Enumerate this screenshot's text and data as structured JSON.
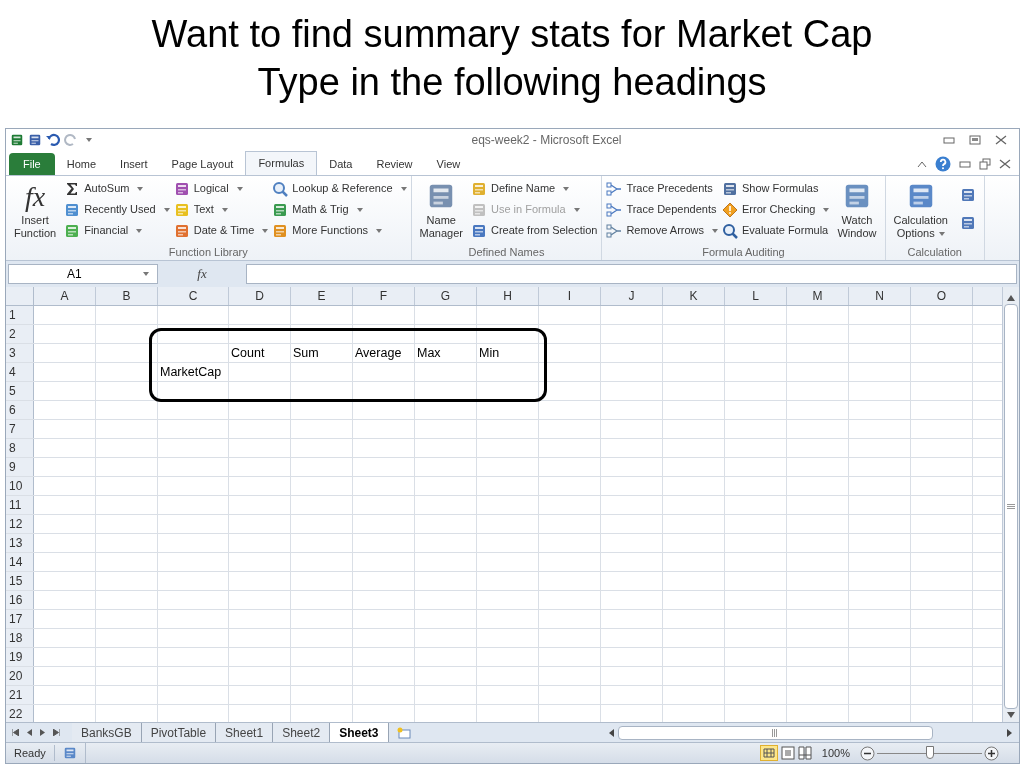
{
  "slide_title": [
    "Want to find summary stats for Market Cap",
    "Type in the following headings"
  ],
  "window": {
    "title": "eqs-week2 - Microsoft Excel"
  },
  "ribbon_tabs": [
    {
      "label": "File",
      "kind": "file",
      "selected": false
    },
    {
      "label": "Home",
      "kind": "tab",
      "selected": false
    },
    {
      "label": "Insert",
      "kind": "tab",
      "selected": false
    },
    {
      "label": "Page Layout",
      "kind": "tab",
      "selected": false
    },
    {
      "label": "Formulas",
      "kind": "tab",
      "selected": true
    },
    {
      "label": "Data",
      "kind": "tab",
      "selected": false
    },
    {
      "label": "Review",
      "kind": "tab",
      "selected": false
    },
    {
      "label": "View",
      "kind": "tab",
      "selected": false
    }
  ],
  "ribbon_groups": [
    {
      "label": "Function Library",
      "controls": [
        {
          "kind": "big",
          "glyph": "fx",
          "lines": [
            "Insert",
            "Function"
          ],
          "dropdown": false
        },
        {
          "kind": "stack",
          "items": [
            {
              "kind": "text",
              "label": "AutoSum",
              "dropdown": true,
              "disabled": false
            },
            {
              "kind": "text",
              "label": "Recently Used",
              "dropdown": true,
              "disabled": false
            },
            {
              "kind": "text",
              "label": "Financial",
              "dropdown": true,
              "disabled": false
            }
          ]
        },
        {
          "kind": "stack",
          "items": [
            {
              "kind": "text",
              "label": "Logical",
              "dropdown": true,
              "disabled": false
            },
            {
              "kind": "text",
              "label": "Text",
              "dropdown": true,
              "disabled": false
            },
            {
              "kind": "text",
              "label": "Date & Time",
              "dropdown": true,
              "disabled": false
            }
          ]
        },
        {
          "kind": "stack",
          "items": [
            {
              "kind": "text",
              "label": "Lookup & Reference",
              "dropdown": true,
              "disabled": false
            },
            {
              "kind": "text",
              "label": "Math & Trig",
              "dropdown": true,
              "disabled": false
            },
            {
              "kind": "text",
              "label": "More Functions",
              "dropdown": true,
              "disabled": false
            }
          ]
        }
      ]
    },
    {
      "label": "Defined Names",
      "controls": [
        {
          "kind": "big",
          "lines": [
            "Name",
            "Manager"
          ],
          "dropdown": false
        },
        {
          "kind": "stack",
          "items": [
            {
              "kind": "text",
              "label": "Define Name",
              "dropdown": true,
              "disabled": false
            },
            {
              "kind": "text",
              "label": "Use in Formula",
              "dropdown": true,
              "disabled": true
            },
            {
              "kind": "text",
              "label": "Create from Selection",
              "dropdown": false,
              "disabled": false
            }
          ]
        }
      ]
    },
    {
      "label": "Formula Auditing",
      "controls": [
        {
          "kind": "stack",
          "items": [
            {
              "kind": "text",
              "label": "Trace Precedents",
              "dropdown": false,
              "disabled": false
            },
            {
              "kind": "text",
              "label": "Trace Dependents",
              "dropdown": false,
              "disabled": false
            },
            {
              "kind": "text",
              "label": "Remove Arrows",
              "dropdown": true,
              "disabled": false
            }
          ]
        },
        {
          "kind": "stack",
          "items": [
            {
              "kind": "text",
              "label": "Show Formulas",
              "dropdown": false,
              "disabled": false
            },
            {
              "kind": "text",
              "label": "Error Checking",
              "dropdown": true,
              "disabled": false
            },
            {
              "kind": "text",
              "label": "Evaluate Formula",
              "dropdown": false,
              "disabled": false
            }
          ]
        },
        {
          "kind": "big",
          "lines": [
            "Watch",
            "Window"
          ],
          "dropdown": false
        }
      ]
    },
    {
      "label": "Calculation",
      "controls": [
        {
          "kind": "big",
          "lines": [
            "Calculation",
            "Options"
          ],
          "dropdown": true
        },
        {
          "kind": "stack",
          "items": [
            {
              "kind": "icon"
            },
            {
              "kind": "icon"
            }
          ]
        }
      ]
    }
  ],
  "formula_bar": {
    "name_box": "A1",
    "fx": "fx"
  },
  "columns": [
    "A",
    "B",
    "C",
    "D",
    "E",
    "F",
    "G",
    "H",
    "I",
    "J",
    "K",
    "L",
    "M",
    "N",
    "O"
  ],
  "rows": [
    {
      "label": "1"
    },
    {
      "label": "2"
    },
    {
      "label": "3",
      "cells": [
        null,
        null,
        null,
        "Count",
        "Sum",
        "Average",
        "Max",
        "Min"
      ]
    },
    {
      "label": "4",
      "cells": [
        null,
        null,
        "MarketCap"
      ]
    },
    {
      "label": "5"
    },
    {
      "label": "6"
    },
    {
      "label": "7"
    },
    {
      "label": "8"
    },
    {
      "label": "9"
    },
    {
      "label": "10"
    },
    {
      "label": "11"
    },
    {
      "label": "12"
    },
    {
      "label": "13"
    },
    {
      "label": "14"
    },
    {
      "label": "15"
    },
    {
      "label": "16"
    },
    {
      "label": "17"
    },
    {
      "label": "18"
    },
    {
      "label": "19"
    },
    {
      "label": "20"
    },
    {
      "label": "21"
    },
    {
      "label": "22"
    }
  ],
  "sheet_tabs": [
    {
      "label": "BanksGB",
      "selected": false
    },
    {
      "label": "PivotTable",
      "selected": false
    },
    {
      "label": "Sheet1",
      "selected": false
    },
    {
      "label": "Sheet2",
      "selected": false
    },
    {
      "label": "Sheet3",
      "selected": true
    }
  ],
  "status_bar": {
    "status": "Ready",
    "zoom": "100%",
    "zoom_slider": {
      "level": 0.5
    }
  }
}
